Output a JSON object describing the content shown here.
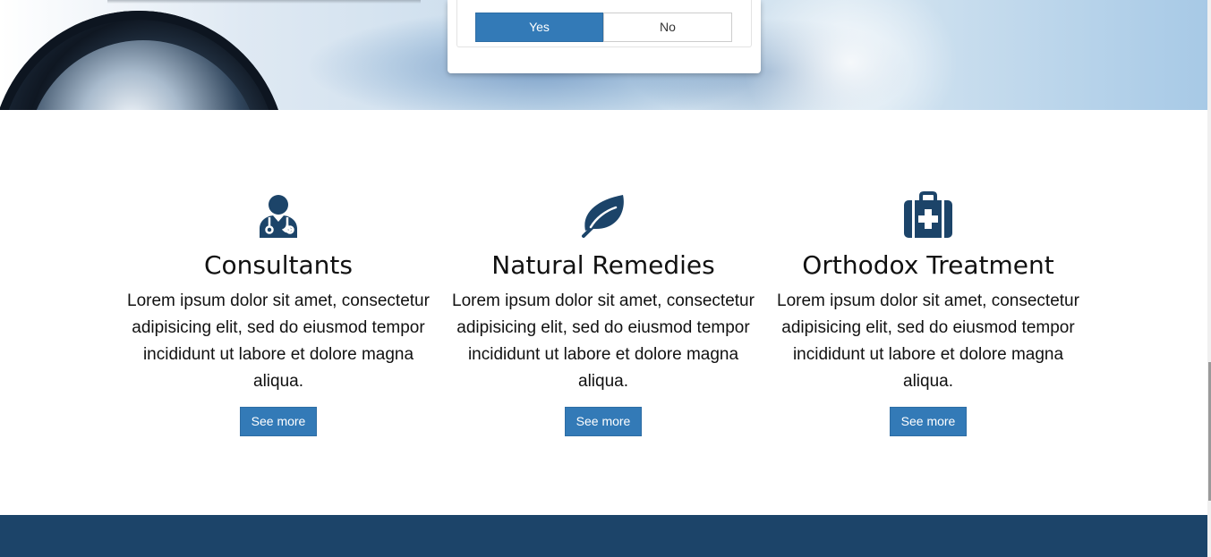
{
  "poll": {
    "yes_label": "Yes",
    "no_label": "No"
  },
  "features": [
    {
      "icon": "doctor-icon",
      "title": "Consultants",
      "text": "Lorem ipsum dolor sit amet, consectetur adipisicing elit, sed do eiusmod tempor incididunt ut labore et dolore magna aliqua.",
      "button": "See more"
    },
    {
      "icon": "leaf-icon",
      "title": "Natural Remedies",
      "text": "Lorem ipsum dolor sit amet, consectetur adipisicing elit, sed do eiusmod tempor incididunt ut labore et dolore magna aliqua.",
      "button": "See more"
    },
    {
      "icon": "medkit-icon",
      "title": "Orthodox Treatment",
      "text": "Lorem ipsum dolor sit amet, consectetur adipisicing elit, sed do eiusmod tempor incididunt ut labore et dolore magna aliqua.",
      "button": "See more"
    }
  ],
  "colors": {
    "primary_button": "#337ab7",
    "icon": "#1c4469",
    "footer": "#1c4469"
  }
}
